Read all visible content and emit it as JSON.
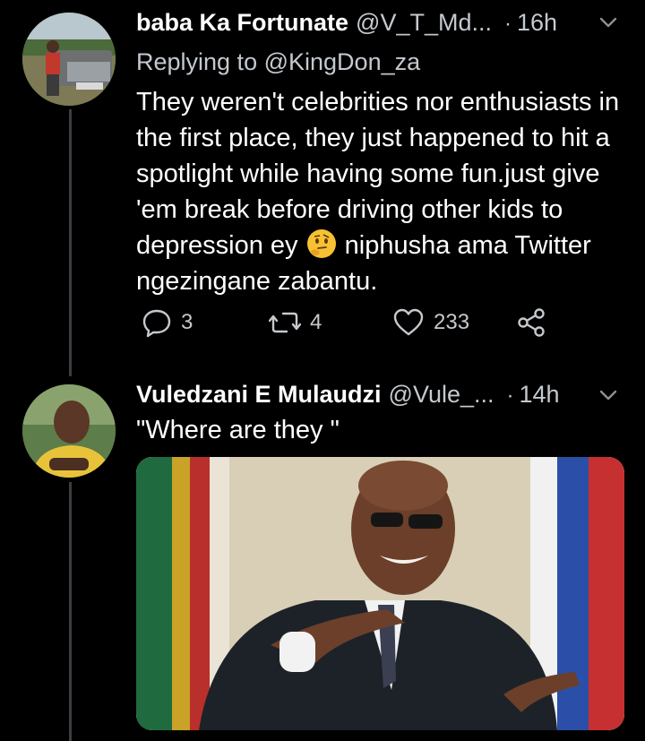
{
  "tweets": [
    {
      "display_name": "baba Ka Fortunate",
      "handle": "@V_T_Md...",
      "separator": "·",
      "time": "16h",
      "replying_prefix": "Replying to",
      "replying_to": "@KingDon_za",
      "text_before_emoji": "They weren't celebrities nor enthusiasts in the first place, they just happened to hit a spotlight while having some fun.just give 'em  break before driving other kids to depression ey ",
      "emoji": "thinking-face",
      "text_after_emoji": " niphusha ama Twitter ngezingane zabantu.",
      "replies": "3",
      "retweets": "4",
      "likes": "233"
    },
    {
      "display_name": "Vuledzani E Mulaudzi",
      "handle": "@Vule_...",
      "separator": "·",
      "time": "14h",
      "text": "\"Where are they \""
    }
  ],
  "icons": {
    "reply": "reply-bubble-icon",
    "retweet": "retweet-icon",
    "like": "heart-icon",
    "share": "share-icon",
    "menu": "chevron-down-icon"
  },
  "colors": {
    "background": "#000000",
    "text": "#ffffff",
    "secondary_text": "#c4c9ce",
    "thread_line": "#3a3e42"
  }
}
